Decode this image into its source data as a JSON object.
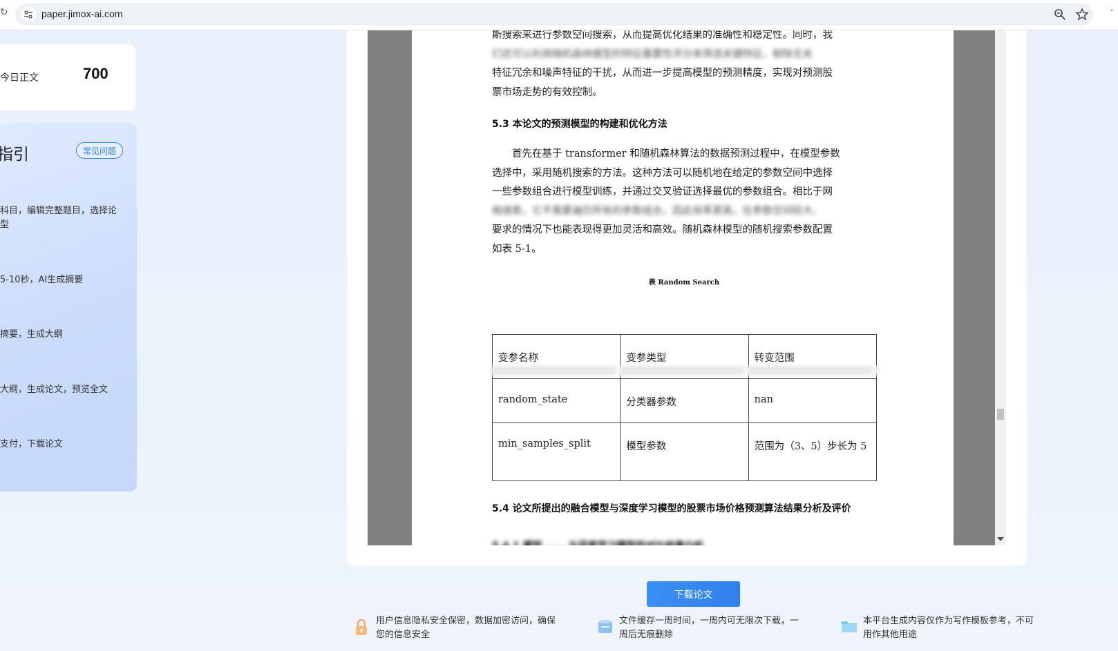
{
  "browser": {
    "url": "paper.jimox-ai.com",
    "left_edge_glyph": "↻",
    "right_edge_glyph": "ˇ"
  },
  "stats": {
    "label": "今日正文",
    "value": "700"
  },
  "guide": {
    "title": "指引",
    "faq_label": "常见问题",
    "steps": [
      {
        "line1": "科目，编辑完整题目，选择论",
        "line2": "型"
      },
      {
        "line1": "5-10秒，AI生成摘要",
        "line2": ""
      },
      {
        "line1": "摘要，生成大纲",
        "line2": ""
      },
      {
        "line1": "大纲，生成论文，预览全文",
        "line2": ""
      },
      {
        "line1": "支付，下载论文",
        "line2": ""
      }
    ]
  },
  "document": {
    "top_lines": [
      "斯搜索来进行参数空间搜索，从而提高优化结果的准确性和稳定性。同时，我",
      "们还可以利用随机森林模型的特征重要性评分来筛选关键特征，剔除无关",
      "特征冗余和噪声特征的干扰，从而进一步提高模型的预测精度，实现对预测股",
      "票市场走势的有效控制。"
    ],
    "heading_5_3": "5.3  本论文的预测模型的构建和优化方法",
    "para_lines": [
      "　　首先在基于 transformer 和随机森林算法的数据预测过程中，在模型参数",
      "选择中，采用随机搜索的方法。这种方法可以随机地在给定的参数空间中选择",
      "一些参数组合进行模型训练，并通过交叉验证选择最优的参数组合。相比于网",
      "格搜索，它不需要遍历所有的参数组合，因此效率更高，在参数空间较大、",
      "要求的情况下也能表现得更加灵活和高效。随机森林模型的随机搜索参数配置",
      "如表 5-1。"
    ],
    "table_caption": "表 Random Search",
    "table": {
      "headers": [
        "变参名称",
        "变参类型",
        "转变范围"
      ],
      "rows": [
        [
          "random_state",
          "分类器参数",
          "nan"
        ],
        [
          "min_samples_split",
          "模型参数",
          "范围为（3、5）步长为 5"
        ]
      ]
    },
    "heading_5_4": "5.4  论文所提出的融合模型与深度学习模型的股票市场价格预测算法结果分析及评价",
    "bottom_line": "5.4.1  模型 ……  与深度学习模型的对比结果分析"
  },
  "footer": {
    "download_label": "下载论文",
    "notes": [
      {
        "icon": "lock-icon",
        "line1": "用户信息隐私安全保密，数据加密访问，确保",
        "line2": "您的信息安全"
      },
      {
        "icon": "file-cache-icon",
        "line1": "文件缓存一周时间，一周内可无限次下载，一",
        "line2": "周后无痕删除"
      },
      {
        "icon": "folder-icon",
        "line1": "本平台生成内容仅作为写作模板参考，不可",
        "line2": "用作其他用途"
      }
    ]
  },
  "colors": {
    "accent": "#2f80ed",
    "viewer_gray": "#808080",
    "guide_bg": "#cbdcfb"
  }
}
